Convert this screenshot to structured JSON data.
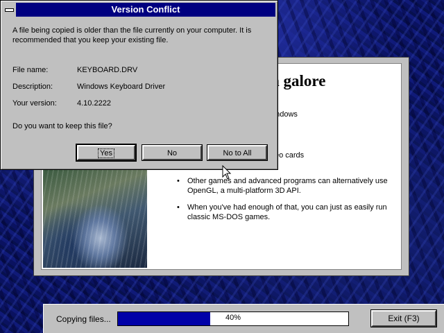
{
  "dialog": {
    "title": "Version Conflict",
    "message_line1": "A file being copied is older than the file currently on your computer. It is",
    "message_line2": "recommended that you keep your existing file.",
    "fields": [
      {
        "label": "File name:",
        "value": "KEYBOARD.DRV"
      },
      {
        "label": "Description:",
        "value": "Windows Keyboard Driver"
      },
      {
        "label": "Your version:",
        "value": "4.10.2222"
      }
    ],
    "question": "Do you want to keep this file?",
    "buttons": {
      "yes": "Yes",
      "no": "No",
      "no_to_all": "No to All"
    }
  },
  "setup": {
    "heading": "n galore",
    "bullets": [
      {
        "line1": "ames for MS-DOS and Windows",
        "line2": ""
      },
      {
        "line1": "any games on popular video cards",
        "line2": ""
      },
      {
        "line1": "Other games and advanced programs can alternatively use",
        "line2": "OpenGL, a multi-platform 3D API."
      },
      {
        "line1": "When you've had enough of that, you can just as easily run",
        "line2": "classic MS-DOS games."
      }
    ],
    "bullet_glyph": "•"
  },
  "status": {
    "label": "Copying files...",
    "progress_text": "40%",
    "progress_fraction": 0.4,
    "exit_label": "Exit (F3)"
  },
  "colors": {
    "titlebar": "#000080",
    "progress_fill": "#0000a8",
    "face": "#c0c0c0"
  }
}
